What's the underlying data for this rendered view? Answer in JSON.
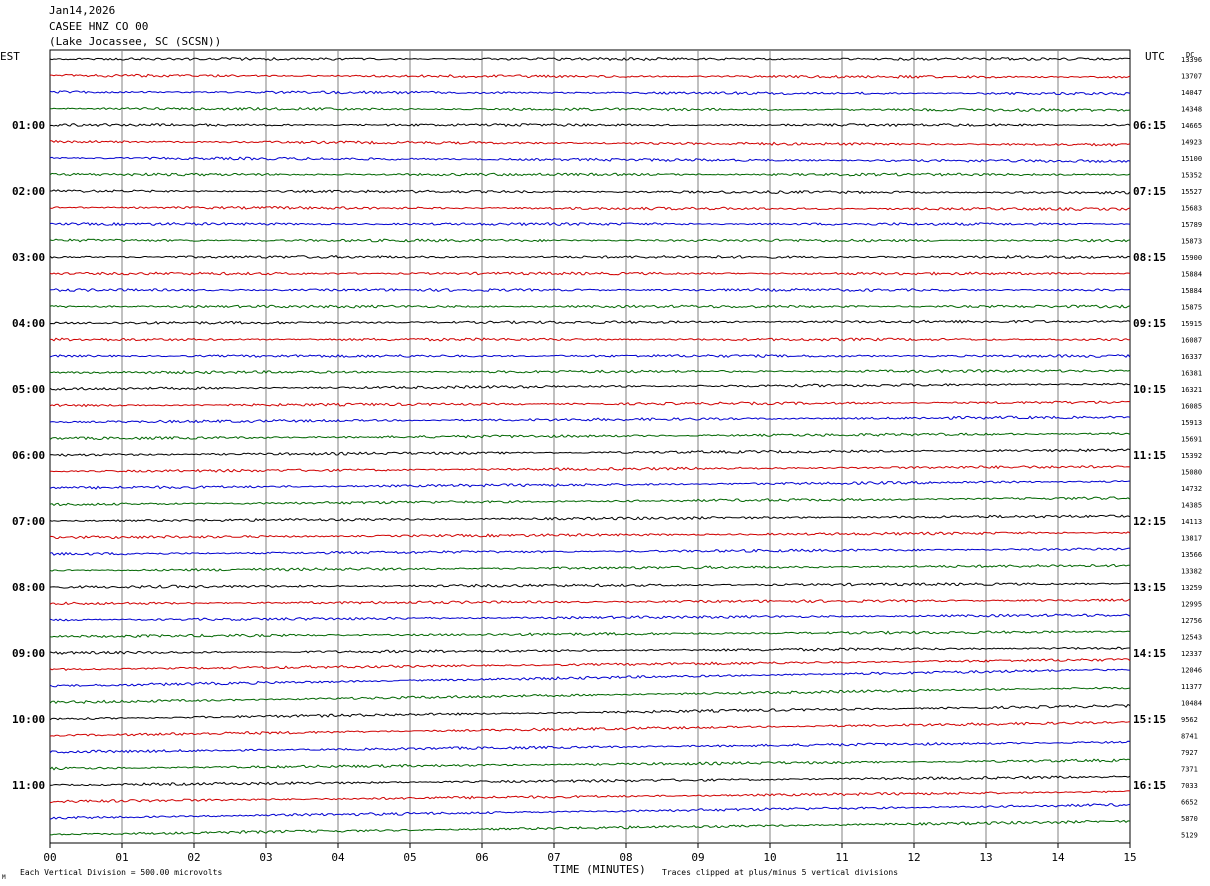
{
  "header": {
    "date": "Jan14,2026",
    "station": "CASEE HNZ CO 00",
    "location": "(Lake Jocassee, SC (SCSN))"
  },
  "left_axis_title": "EST",
  "right_axis_title": "UTC",
  "dc_header": "DC",
  "footer": {
    "scale_note": "Each Vertical Division =  500.00 microvolts",
    "x_title": "TIME (MINUTES)",
    "clip_note": "Traces clipped at plus/minus 5 vertical divisions",
    "corner_mark": "M"
  },
  "colors": {
    "trace_cycle": [
      "#000000",
      "#d00000",
      "#0000d0",
      "#006600"
    ],
    "grid": "#808080"
  },
  "chart_data": {
    "type": "line",
    "title": "",
    "x": [
      0,
      15
    ],
    "xlim": [
      0,
      15
    ],
    "x_tick_labels": [
      "00",
      "01",
      "02",
      "03",
      "04",
      "05",
      "06",
      "07",
      "08",
      "09",
      "10",
      "11",
      "12",
      "13",
      "14",
      "15"
    ],
    "xlabel": "TIME (MINUTES)",
    "ylabel": "",
    "grid": true,
    "legend": "none",
    "rows_per_hour": 4,
    "left_hour_labels": [
      "01:00",
      "02:00",
      "03:00",
      "04:00",
      "05:00",
      "06:00",
      "07:00",
      "08:00",
      "09:00",
      "10:00",
      "11:00"
    ],
    "right_hour_labels": [
      "06:15",
      "07:15",
      "08:15",
      "09:15",
      "10:15",
      "11:15",
      "12:15",
      "13:15",
      "14:15",
      "15:15",
      "16:15"
    ],
    "dc_values": [
      13396,
      13707,
      14047,
      14348,
      14665,
      14923,
      15100,
      15352,
      15527,
      15683,
      15789,
      15873,
      15900,
      15884,
      15884,
      15875,
      15915,
      16087,
      16337,
      16381,
      16321,
      16085,
      15913,
      15691,
      15392,
      15080,
      14732,
      14385,
      14113,
      13817,
      13566,
      13382,
      13259,
      12995,
      12756,
      12543,
      12337,
      12046,
      11377,
      10484,
      9562,
      8741,
      7927,
      7371,
      7033,
      6652,
      5870,
      5129
    ],
    "series": [
      {
        "values": [
          0,
          0.0
        ]
      },
      {
        "values": [
          0,
          -0.1
        ]
      },
      {
        "values": [
          0,
          -0.1
        ]
      },
      {
        "values": [
          0,
          -0.1
        ]
      },
      {
        "values": [
          0,
          0.0
        ]
      },
      {
        "values": [
          0,
          -0.2
        ]
      },
      {
        "values": [
          0,
          -0.2
        ]
      },
      {
        "values": [
          0,
          0.0
        ]
      },
      {
        "values": [
          0,
          -0.1
        ]
      },
      {
        "values": [
          0,
          -0.1
        ]
      },
      {
        "values": [
          0,
          0.0
        ]
      },
      {
        "values": [
          0,
          0.0
        ]
      },
      {
        "values": [
          0,
          0.0
        ]
      },
      {
        "values": [
          0,
          0.0
        ]
      },
      {
        "values": [
          0,
          0.0
        ]
      },
      {
        "values": [
          0,
          0.0
        ]
      },
      {
        "values": [
          0,
          0.1
        ]
      },
      {
        "values": [
          0,
          0.0
        ]
      },
      {
        "values": [
          0,
          0.0
        ]
      },
      {
        "values": [
          0,
          0.1
        ]
      },
      {
        "values": [
          0,
          0.3
        ]
      },
      {
        "values": [
          0,
          0.2
        ]
      },
      {
        "values": [
          0,
          0.3
        ]
      },
      {
        "values": [
          0,
          0.3
        ]
      },
      {
        "values": [
          0,
          0.3
        ]
      },
      {
        "values": [
          0,
          0.3
        ]
      },
      {
        "values": [
          0,
          0.4
        ]
      },
      {
        "values": [
          0,
          0.4
        ]
      },
      {
        "values": [
          0,
          0.3
        ]
      },
      {
        "values": [
          0,
          0.3
        ]
      },
      {
        "values": [
          0,
          0.3
        ]
      },
      {
        "values": [
          0,
          0.3
        ]
      },
      {
        "values": [
          0,
          0.2
        ]
      },
      {
        "values": [
          0,
          0.2
        ]
      },
      {
        "values": [
          0,
          0.3
        ]
      },
      {
        "values": [
          0,
          0.3
        ]
      },
      {
        "values": [
          0,
          0.3
        ]
      },
      {
        "values": [
          0,
          0.6
        ]
      },
      {
        "values": [
          0,
          1.0
        ]
      },
      {
        "values": [
          0,
          0.9
        ]
      },
      {
        "values": [
          0,
          0.8
        ]
      },
      {
        "values": [
          0,
          0.8
        ]
      },
      {
        "values": [
          0,
          0.6
        ]
      },
      {
        "values": [
          0,
          0.5
        ]
      },
      {
        "values": [
          0,
          0.5
        ]
      },
      {
        "values": [
          0,
          0.6
        ]
      },
      {
        "values": [
          0,
          0.8
        ]
      },
      {
        "values": [
          0,
          0.8
        ]
      }
    ]
  }
}
